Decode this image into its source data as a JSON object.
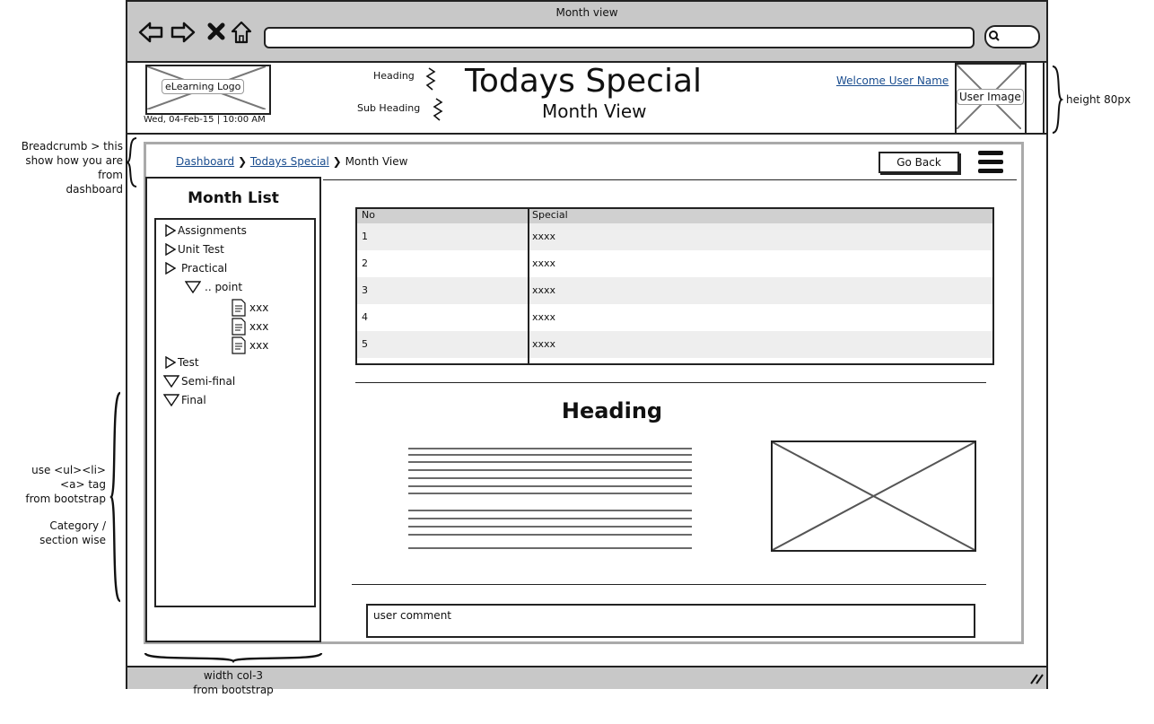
{
  "window": {
    "title": "Month view"
  },
  "header": {
    "logo_label": "eLearning Logo",
    "date": "Wed, 04-Feb-15 | 10:00 AM",
    "heading_label": "Heading",
    "subheading_label": "Sub Heading",
    "title": "Todays Special",
    "subtitle": "Month View",
    "welcome": "Welcome User Name",
    "user_image_label": "User Image"
  },
  "breadcrumb": {
    "items": [
      "Dashboard",
      "Todays Special"
    ],
    "current": "Month View",
    "separator": "❯"
  },
  "go_back_label": "Go Back",
  "sidebar": {
    "title": "Month List",
    "items": [
      {
        "label": "Assignments",
        "state": "collapsed"
      },
      {
        "label": "Unit Test",
        "state": "collapsed"
      },
      {
        "label": "Practical",
        "state": "collapsed"
      },
      {
        "label": ".. point",
        "state": "expanded"
      },
      {
        "label": "xxx",
        "state": "file"
      },
      {
        "label": "xxx",
        "state": "file"
      },
      {
        "label": "xxx",
        "state": "file"
      },
      {
        "label": "Test",
        "state": "collapsed"
      },
      {
        "label": "Semi-final",
        "state": "expanded"
      },
      {
        "label": "Final",
        "state": "expanded"
      }
    ]
  },
  "table": {
    "headers": [
      "No",
      "Special"
    ],
    "rows": [
      [
        "1",
        "xxxx"
      ],
      [
        "2",
        "xxxx"
      ],
      [
        "3",
        "xxxx"
      ],
      [
        "4",
        "xxxx"
      ],
      [
        "5",
        "xxxx"
      ]
    ]
  },
  "section_heading": "Heading",
  "comment_placeholder": "user comment",
  "annotations": {
    "breadcrumb_note": [
      "Breadcrumb > this",
      "show how you are from",
      "dashboard"
    ],
    "ul_note": [
      "use <ul><li>",
      "<a> tag",
      "from bootstrap"
    ],
    "category_note": [
      "Category /",
      "section wise"
    ],
    "height_note": "height 80px",
    "width_note": [
      "width col-3",
      "from bootstrap"
    ]
  },
  "colors": {
    "chrome": "#c8c8c8",
    "link": "#1a4d8f",
    "table_header": "#d0d0d0",
    "row_alt": "#eeeeee"
  }
}
